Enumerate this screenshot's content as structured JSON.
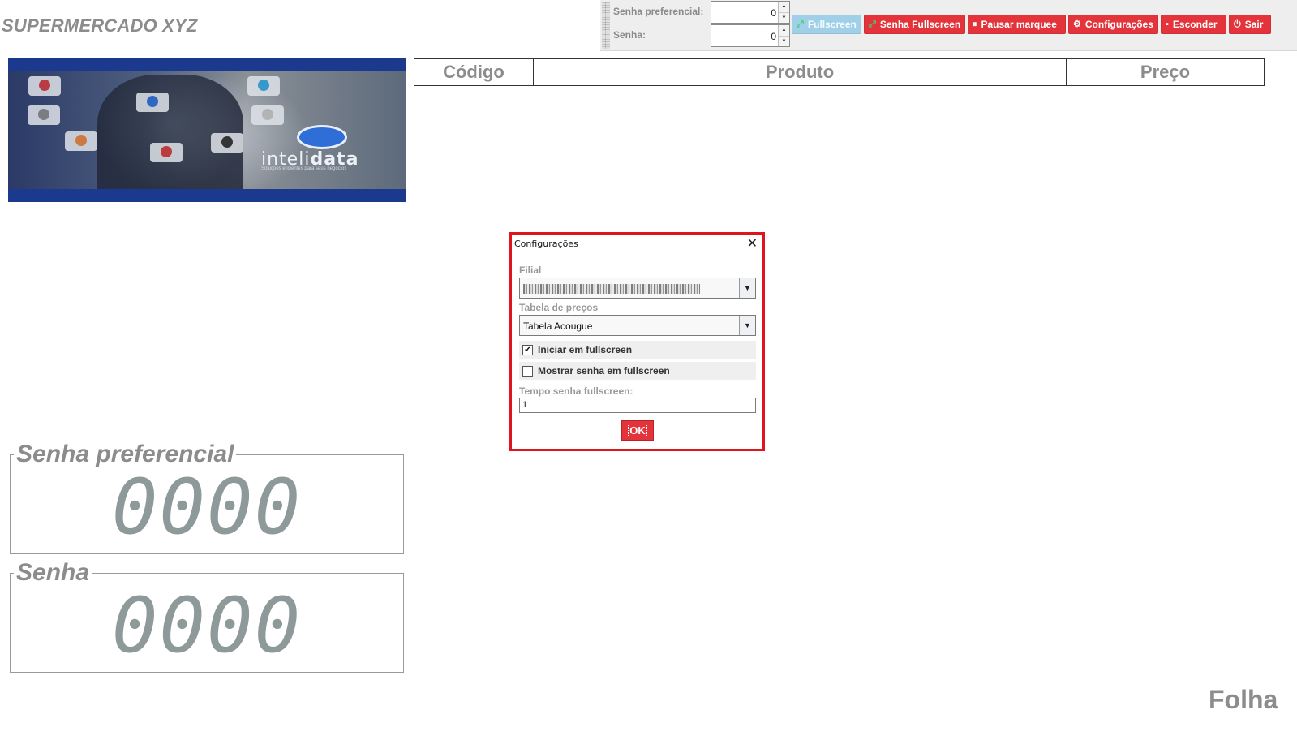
{
  "app": {
    "title": "SUPERMERCADO XYZ"
  },
  "toolbar": {
    "senha_preferencial_label": "Senha preferencial:",
    "senha_preferencial_value": "0",
    "senha_label": "Senha:",
    "senha_value": "0",
    "buttons": {
      "fullscreen": "Fullscreen",
      "senha_fullscreen": "Senha Fullscreen",
      "pausar_marquee": "Pausar marquee",
      "configuracoes": "Configurações",
      "esconder": "Esconder",
      "sair": "Sair"
    }
  },
  "banner": {
    "logo_word_light": "inteli",
    "logo_word_bold": "data",
    "logo_tagline": "Soluções eficientes para seus negócios"
  },
  "table": {
    "headers": [
      "Código",
      "Produto",
      "Preço"
    ]
  },
  "counters": {
    "preferencial": {
      "title": "Senha preferencial",
      "value": "0000"
    },
    "senha": {
      "title": "Senha",
      "value": "0000"
    }
  },
  "dialog": {
    "title": "Configurações",
    "filial_label": "Filial",
    "tabela_label": "Tabela de preços",
    "tabela_value": "Tabela Acougue",
    "iniciar_fullscreen_label": "Iniciar em fullscreen",
    "iniciar_fullscreen_checked": true,
    "mostrar_senha_label": "Mostrar senha em fullscreen",
    "mostrar_senha_checked": false,
    "tempo_label": "Tempo senha fullscreen:",
    "tempo_value": "1",
    "ok_label": "OK"
  },
  "footer": {
    "text": "Folha"
  },
  "colors": {
    "accent_red": "#e3343b",
    "dialog_border": "#e0141c",
    "fullscreen_button": "#9fd0e8",
    "muted_text": "#8c8c8c"
  }
}
